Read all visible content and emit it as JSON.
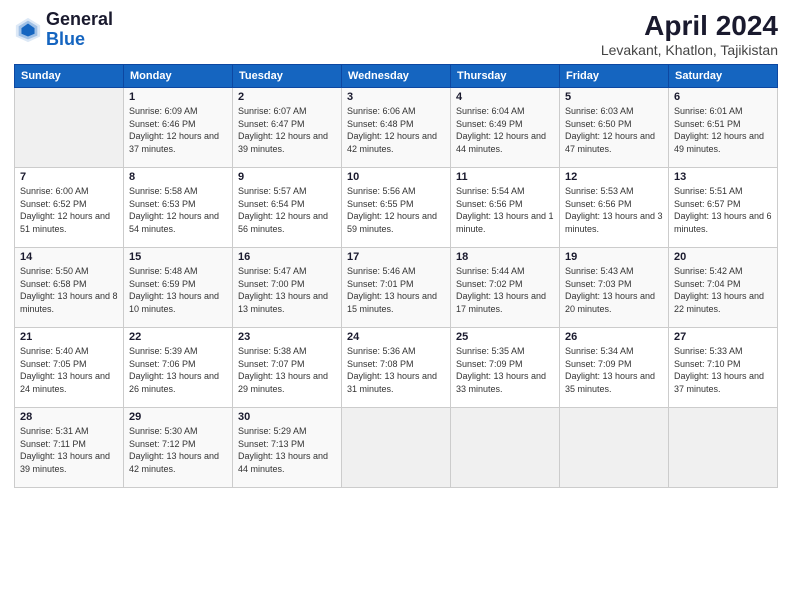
{
  "logo": {
    "general": "General",
    "blue": "Blue"
  },
  "title": "April 2024",
  "subtitle": "Levakant, Khatlon, Tajikistan",
  "days_header": [
    "Sunday",
    "Monday",
    "Tuesday",
    "Wednesday",
    "Thursday",
    "Friday",
    "Saturday"
  ],
  "weeks": [
    [
      {
        "day": "",
        "sunrise": "",
        "sunset": "",
        "daylight": ""
      },
      {
        "day": "1",
        "sunrise": "Sunrise: 6:09 AM",
        "sunset": "Sunset: 6:46 PM",
        "daylight": "Daylight: 12 hours and 37 minutes."
      },
      {
        "day": "2",
        "sunrise": "Sunrise: 6:07 AM",
        "sunset": "Sunset: 6:47 PM",
        "daylight": "Daylight: 12 hours and 39 minutes."
      },
      {
        "day": "3",
        "sunrise": "Sunrise: 6:06 AM",
        "sunset": "Sunset: 6:48 PM",
        "daylight": "Daylight: 12 hours and 42 minutes."
      },
      {
        "day": "4",
        "sunrise": "Sunrise: 6:04 AM",
        "sunset": "Sunset: 6:49 PM",
        "daylight": "Daylight: 12 hours and 44 minutes."
      },
      {
        "day": "5",
        "sunrise": "Sunrise: 6:03 AM",
        "sunset": "Sunset: 6:50 PM",
        "daylight": "Daylight: 12 hours and 47 minutes."
      },
      {
        "day": "6",
        "sunrise": "Sunrise: 6:01 AM",
        "sunset": "Sunset: 6:51 PM",
        "daylight": "Daylight: 12 hours and 49 minutes."
      }
    ],
    [
      {
        "day": "7",
        "sunrise": "Sunrise: 6:00 AM",
        "sunset": "Sunset: 6:52 PM",
        "daylight": "Daylight: 12 hours and 51 minutes."
      },
      {
        "day": "8",
        "sunrise": "Sunrise: 5:58 AM",
        "sunset": "Sunset: 6:53 PM",
        "daylight": "Daylight: 12 hours and 54 minutes."
      },
      {
        "day": "9",
        "sunrise": "Sunrise: 5:57 AM",
        "sunset": "Sunset: 6:54 PM",
        "daylight": "Daylight: 12 hours and 56 minutes."
      },
      {
        "day": "10",
        "sunrise": "Sunrise: 5:56 AM",
        "sunset": "Sunset: 6:55 PM",
        "daylight": "Daylight: 12 hours and 59 minutes."
      },
      {
        "day": "11",
        "sunrise": "Sunrise: 5:54 AM",
        "sunset": "Sunset: 6:56 PM",
        "daylight": "Daylight: 13 hours and 1 minute."
      },
      {
        "day": "12",
        "sunrise": "Sunrise: 5:53 AM",
        "sunset": "Sunset: 6:56 PM",
        "daylight": "Daylight: 13 hours and 3 minutes."
      },
      {
        "day": "13",
        "sunrise": "Sunrise: 5:51 AM",
        "sunset": "Sunset: 6:57 PM",
        "daylight": "Daylight: 13 hours and 6 minutes."
      }
    ],
    [
      {
        "day": "14",
        "sunrise": "Sunrise: 5:50 AM",
        "sunset": "Sunset: 6:58 PM",
        "daylight": "Daylight: 13 hours and 8 minutes."
      },
      {
        "day": "15",
        "sunrise": "Sunrise: 5:48 AM",
        "sunset": "Sunset: 6:59 PM",
        "daylight": "Daylight: 13 hours and 10 minutes."
      },
      {
        "day": "16",
        "sunrise": "Sunrise: 5:47 AM",
        "sunset": "Sunset: 7:00 PM",
        "daylight": "Daylight: 13 hours and 13 minutes."
      },
      {
        "day": "17",
        "sunrise": "Sunrise: 5:46 AM",
        "sunset": "Sunset: 7:01 PM",
        "daylight": "Daylight: 13 hours and 15 minutes."
      },
      {
        "day": "18",
        "sunrise": "Sunrise: 5:44 AM",
        "sunset": "Sunset: 7:02 PM",
        "daylight": "Daylight: 13 hours and 17 minutes."
      },
      {
        "day": "19",
        "sunrise": "Sunrise: 5:43 AM",
        "sunset": "Sunset: 7:03 PM",
        "daylight": "Daylight: 13 hours and 20 minutes."
      },
      {
        "day": "20",
        "sunrise": "Sunrise: 5:42 AM",
        "sunset": "Sunset: 7:04 PM",
        "daylight": "Daylight: 13 hours and 22 minutes."
      }
    ],
    [
      {
        "day": "21",
        "sunrise": "Sunrise: 5:40 AM",
        "sunset": "Sunset: 7:05 PM",
        "daylight": "Daylight: 13 hours and 24 minutes."
      },
      {
        "day": "22",
        "sunrise": "Sunrise: 5:39 AM",
        "sunset": "Sunset: 7:06 PM",
        "daylight": "Daylight: 13 hours and 26 minutes."
      },
      {
        "day": "23",
        "sunrise": "Sunrise: 5:38 AM",
        "sunset": "Sunset: 7:07 PM",
        "daylight": "Daylight: 13 hours and 29 minutes."
      },
      {
        "day": "24",
        "sunrise": "Sunrise: 5:36 AM",
        "sunset": "Sunset: 7:08 PM",
        "daylight": "Daylight: 13 hours and 31 minutes."
      },
      {
        "day": "25",
        "sunrise": "Sunrise: 5:35 AM",
        "sunset": "Sunset: 7:09 PM",
        "daylight": "Daylight: 13 hours and 33 minutes."
      },
      {
        "day": "26",
        "sunrise": "Sunrise: 5:34 AM",
        "sunset": "Sunset: 7:09 PM",
        "daylight": "Daylight: 13 hours and 35 minutes."
      },
      {
        "day": "27",
        "sunrise": "Sunrise: 5:33 AM",
        "sunset": "Sunset: 7:10 PM",
        "daylight": "Daylight: 13 hours and 37 minutes."
      }
    ],
    [
      {
        "day": "28",
        "sunrise": "Sunrise: 5:31 AM",
        "sunset": "Sunset: 7:11 PM",
        "daylight": "Daylight: 13 hours and 39 minutes."
      },
      {
        "day": "29",
        "sunrise": "Sunrise: 5:30 AM",
        "sunset": "Sunset: 7:12 PM",
        "daylight": "Daylight: 13 hours and 42 minutes."
      },
      {
        "day": "30",
        "sunrise": "Sunrise: 5:29 AM",
        "sunset": "Sunset: 7:13 PM",
        "daylight": "Daylight: 13 hours and 44 minutes."
      },
      {
        "day": "",
        "sunrise": "",
        "sunset": "",
        "daylight": ""
      },
      {
        "day": "",
        "sunrise": "",
        "sunset": "",
        "daylight": ""
      },
      {
        "day": "",
        "sunrise": "",
        "sunset": "",
        "daylight": ""
      },
      {
        "day": "",
        "sunrise": "",
        "sunset": "",
        "daylight": ""
      }
    ]
  ]
}
